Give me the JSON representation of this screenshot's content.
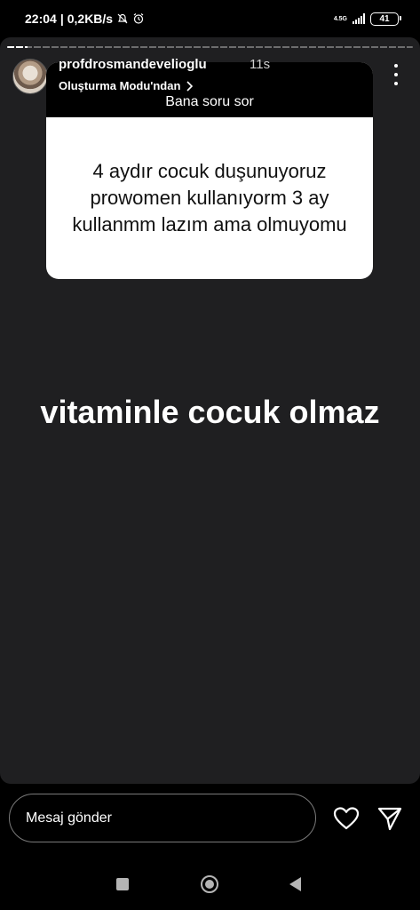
{
  "status_bar": {
    "time": "22:04",
    "separator": "|",
    "data_speed": "0,2KB/s",
    "network_type": "4.5G",
    "battery": "41",
    "icons": [
      "silent-icon",
      "alarm-icon",
      "signal-icon",
      "battery-icon"
    ]
  },
  "story": {
    "progress": 0.05,
    "username": "profdrosmandevelioglu",
    "time_ago": "11s",
    "creation_mode": "Oluşturma Modu'ndan",
    "question_card": {
      "header": "Bana soru sor",
      "question": "4 aydır cocuk duşunuyoruz prowomen kullanıyorm 3 ay kullanmm lazım ama olmuyomu"
    },
    "answer": "vitaminle cocuk olmaz"
  },
  "message_bar": {
    "placeholder": "Mesaj gönder"
  },
  "colors": {
    "story_background": "#1f1f21",
    "card_header": "#000000",
    "card_body": "#ffffff"
  }
}
